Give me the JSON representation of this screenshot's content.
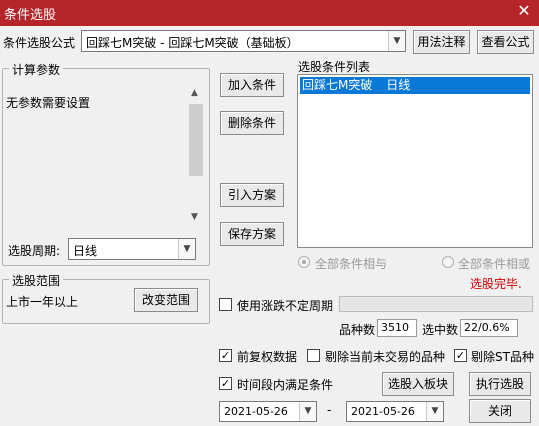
{
  "window": {
    "title": "条件选股",
    "close_glyph": "✕"
  },
  "formula": {
    "label": "条件选股公式",
    "value": "回踩七M突破  - 回踩七M突破（基础板）",
    "arrow": "▼",
    "usage_button": "用法注释",
    "view_button": "查看公式"
  },
  "params": {
    "group_label": "计算参数",
    "empty_text": "无参数需要设置",
    "scroll_up": "▲",
    "scroll_down": "▼",
    "period_label": "选股周期:",
    "period_value": "日线",
    "period_arrow": "▼"
  },
  "conditions": {
    "list_label": "选股条件列表",
    "items": [
      {
        "name": "回踩七M突破",
        "period": "日线"
      }
    ],
    "add_button": "加入条件",
    "delete_button": "删除条件",
    "import_button": "引入方案",
    "save_button": "保存方案",
    "radio_all_and": "全部条件相与",
    "radio_all_or": "全部条件相或",
    "status_text": "选股完毕.",
    "status_color": "#d40000"
  },
  "range": {
    "group_label": "选股范围",
    "value": "上市一年以上",
    "change_button": "改变范围"
  },
  "options": {
    "use_limit_period": {
      "label": "使用涨跌不定周期",
      "checked": false,
      "mark": ""
    },
    "stock_count_label": "品种数",
    "stock_count_value": "3510",
    "selected_count_label": "选中数",
    "selected_count_value": "22/0.6%",
    "forward_adjusted": {
      "label": "前复权数据",
      "checked": true,
      "mark": "✓"
    },
    "exclude_untraded": {
      "label": "剔除当前未交易的品种",
      "checked": false,
      "mark": ""
    },
    "exclude_st": {
      "label": "剔除ST品种",
      "checked": true,
      "mark": "✓"
    },
    "period_satisfy": {
      "label": "时间段内满足条件",
      "checked": true,
      "mark": "✓"
    },
    "select_to_block_button": "选股入板块",
    "execute_button": "执行选股",
    "date_from": "2021-05-26",
    "date_separator": "-",
    "date_to": "2021-05-26",
    "date_arrow": "▼",
    "close_button": "关闭"
  }
}
